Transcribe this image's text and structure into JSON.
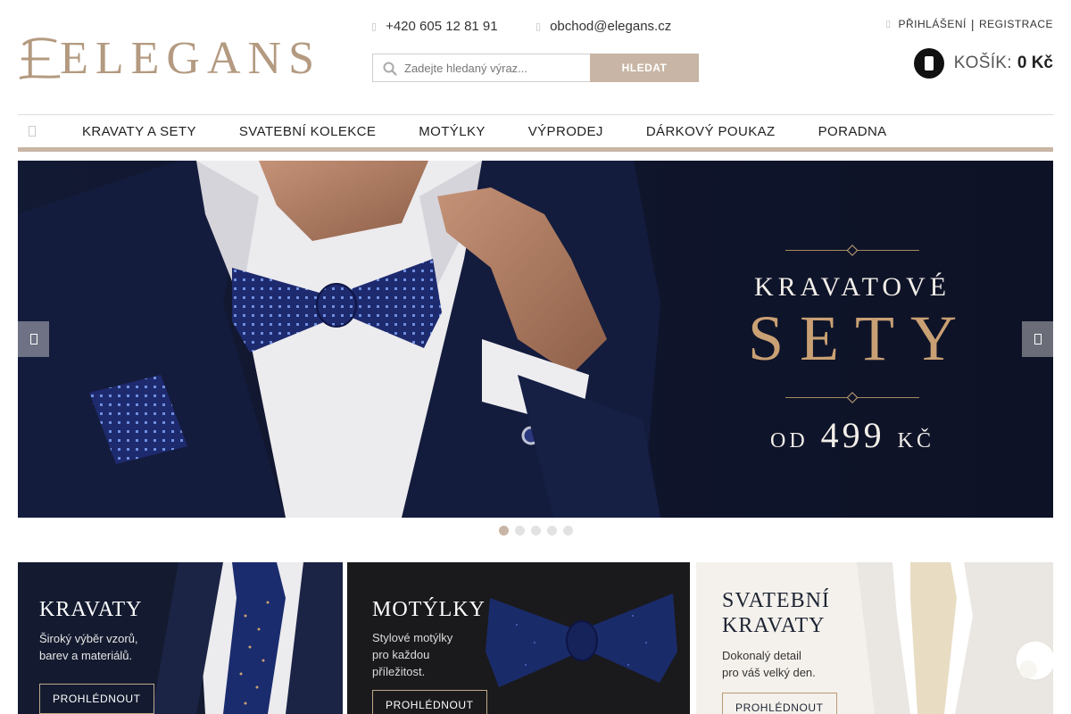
{
  "brand": {
    "name": "ELEGANS",
    "color": "#b39a80"
  },
  "header": {
    "phone": {
      "icon": "phone-icon",
      "text": "+420 605 12 81 91"
    },
    "email": {
      "icon": "mail-icon",
      "text": "obchod@elegans.cz"
    },
    "search": {
      "placeholder": "Zadejte hledaný výraz...",
      "value": "",
      "button_label": "HLEDAT"
    },
    "account": {
      "icon": "user-icon",
      "login_label": "PŘIHLÁŠENÍ",
      "separator": "|",
      "register_label": "REGISTRACE"
    },
    "cart": {
      "icon": "cart-icon",
      "label": "KOŠÍK:",
      "total": "0 Kč"
    }
  },
  "nav": {
    "home_icon": "home-icon",
    "items": [
      {
        "label": "KRAVATY A SETY"
      },
      {
        "label": "SVATEBNÍ KOLEKCE"
      },
      {
        "label": "MOTÝLKY"
      },
      {
        "label": "VÝPRODEJ"
      },
      {
        "label": "DÁRKOVÝ POUKAZ"
      },
      {
        "label": "PORADNA"
      }
    ]
  },
  "hero": {
    "line1": "KRAVATOVÉ",
    "line2": "SETY",
    "price_prefix": "OD",
    "price_value": "499",
    "price_currency": "KČ",
    "prev_icon": "chevron-left-icon",
    "next_icon": "chevron-right-icon",
    "slides_count": 5,
    "active_slide": 1
  },
  "banners": [
    {
      "title": "KRAVATY",
      "desc_line1": "Široký výběr vzorů,",
      "desc_line2": "barev a materiálů.",
      "desc_line3": "",
      "button": "PROHLÉDNOUT"
    },
    {
      "title": "MOTÝLKY",
      "desc_line1": "Stylové motýlky",
      "desc_line2": "pro každou",
      "desc_line3": "příležitost.",
      "button": "PROHLÉDNOUT"
    },
    {
      "title_line1": "SVATEBNÍ",
      "title_line2": "KRAVATY",
      "desc_line1": "Dokonalý detail",
      "desc_line2": "pro váš velký den.",
      "button": "PROHLÉDNOUT"
    }
  ],
  "colors": {
    "accent": "#c8b5a5",
    "hero_bg": "#0f1429",
    "gold": "#c9a074"
  }
}
